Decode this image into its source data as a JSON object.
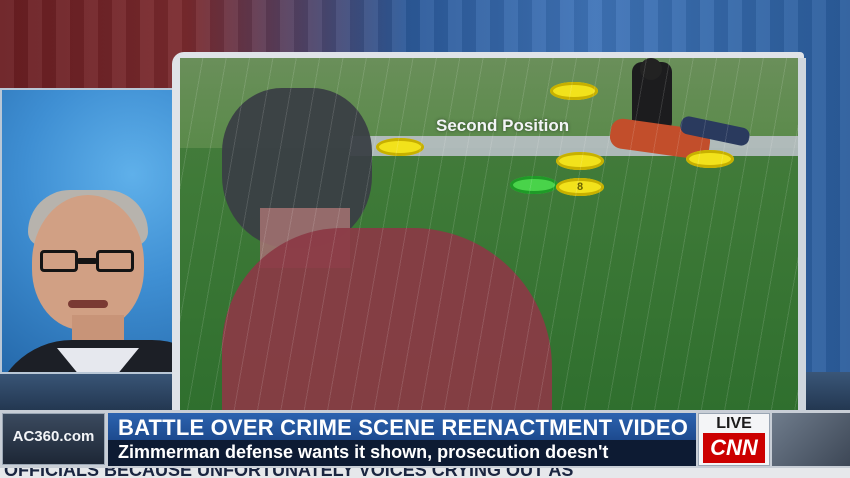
{
  "reenactment": {
    "position_label": "Second Position",
    "markers": [
      {
        "label": "",
        "color": "#f2e21b"
      },
      {
        "label": "",
        "color": "#f2e21b"
      },
      {
        "label": "",
        "color": "#f2e21b"
      },
      {
        "label": "",
        "color": "#49d34a"
      },
      {
        "label": "8",
        "color": "#f2e21b"
      },
      {
        "label": "",
        "color": "#f2e21b"
      }
    ]
  },
  "lower_third": {
    "show_tag": "AC360.com",
    "headline": "BATTLE OVER CRIME SCENE REENACTMENT VIDEO",
    "subline": "Zimmerman defense wants it shown, prosecution doesn't",
    "live_label": "LIVE",
    "network_logo": "CNN",
    "ticker_text": "OFFICIALS BECAUSE UNFORTUNATELY VOICES CRYING OUT AS"
  },
  "colors": {
    "headline_bg": "#2c63b0",
    "subline_bg": "#0d1b33",
    "cnn_red": "#cc0000"
  }
}
